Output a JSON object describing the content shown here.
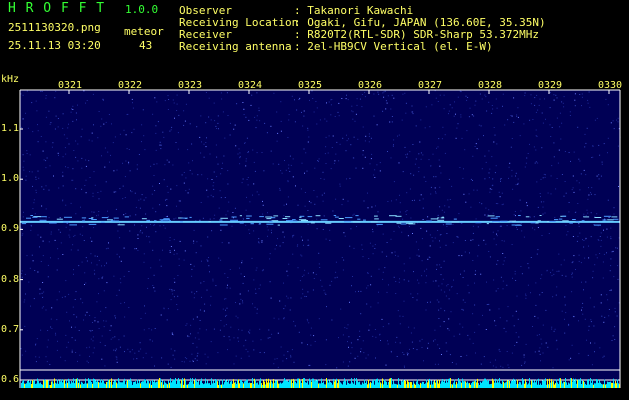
{
  "app": {
    "title": "H R O F F T",
    "version": "1.0.0"
  },
  "file": {
    "name": "2511130320.png",
    "datetime": "25.11.13 03:20"
  },
  "meteor": {
    "label": "meteor",
    "count": "43"
  },
  "info": [
    {
      "label": "Observer",
      "value": ": Takanori Kawachi"
    },
    {
      "label": "Receiving Location",
      "value": ": Ogaki, Gifu, JAPAN (136.60E, 35.35N)"
    },
    {
      "label": "Receiver",
      "value": ": R820T2(RTL-SDR) SDR-Sharp 53.372MHz"
    },
    {
      "label": "Receiving antenna",
      "value": ": 2el-HB9CV Vertical (el. E-W)"
    }
  ],
  "spectrogram": {
    "y_unit": "kHz",
    "x_ticks": [
      "0321",
      "0322",
      "0323",
      "0324",
      "0325",
      "0326",
      "0327",
      "0328",
      "0329",
      "0330"
    ],
    "y_ticks": [
      "1.1",
      "1.0",
      "0.9",
      "0.8",
      "0.7",
      "0.6"
    ],
    "signal_freq_khz": 0.915,
    "colors": {
      "background": "#000055",
      "signal": "#66ccff",
      "frame": "#ffffff",
      "axis_text": "#ffff66",
      "level_bar": "#00e5ff",
      "level_peak": "#ffff00"
    }
  }
}
